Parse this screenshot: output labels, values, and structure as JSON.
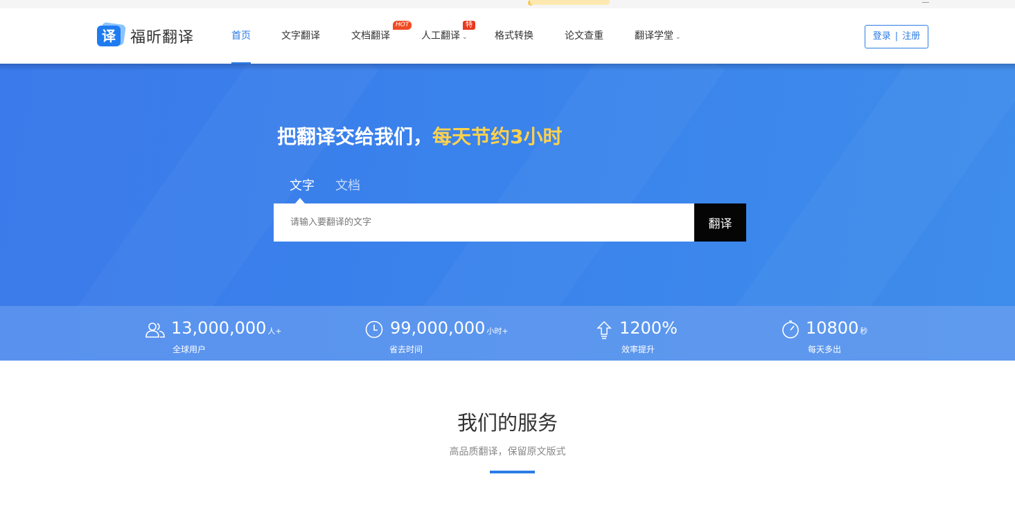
{
  "brand": {
    "logo_glyph": "译",
    "name": "福昕翻译",
    "color": "#1e7cf0"
  },
  "nav": {
    "items": [
      {
        "label": "首页",
        "active": true
      },
      {
        "label": "文字翻译"
      },
      {
        "label": "文档翻译",
        "badge": "HOT"
      },
      {
        "label": "人工翻译",
        "badge": "特价",
        "dropdown": true
      },
      {
        "label": "格式转换"
      },
      {
        "label": "论文查重"
      },
      {
        "label": "翻译学堂",
        "dropdown": true
      }
    ],
    "caret": "⌄"
  },
  "auth": {
    "login": "登录",
    "separator": "|",
    "register": "注册"
  },
  "hero": {
    "title_main": "把翻译交给我们，",
    "title_highlight": "每天节约3小时",
    "highlight_color": "#ffd24d",
    "tabs": [
      {
        "label": "文字",
        "active": true
      },
      {
        "label": "文档"
      }
    ],
    "search_placeholder": "请输入要翻译的文字",
    "translate_button": "翻译"
  },
  "stats": [
    {
      "icon": "users-icon",
      "value": "13,000,000",
      "unit": "人+",
      "label": "全球用户"
    },
    {
      "icon": "clock-icon",
      "value": "99,000,000",
      "unit": "小时+",
      "label": "省去时间"
    },
    {
      "icon": "arrow-up-icon",
      "value": "1200%",
      "unit": "",
      "label": "效率提升"
    },
    {
      "icon": "stopwatch-icon",
      "value": "10800",
      "unit": "秒",
      "label": "每天多出"
    }
  ],
  "services": {
    "title": "我们的服务",
    "subtitle": "高品质翻译，保留原文版式"
  }
}
